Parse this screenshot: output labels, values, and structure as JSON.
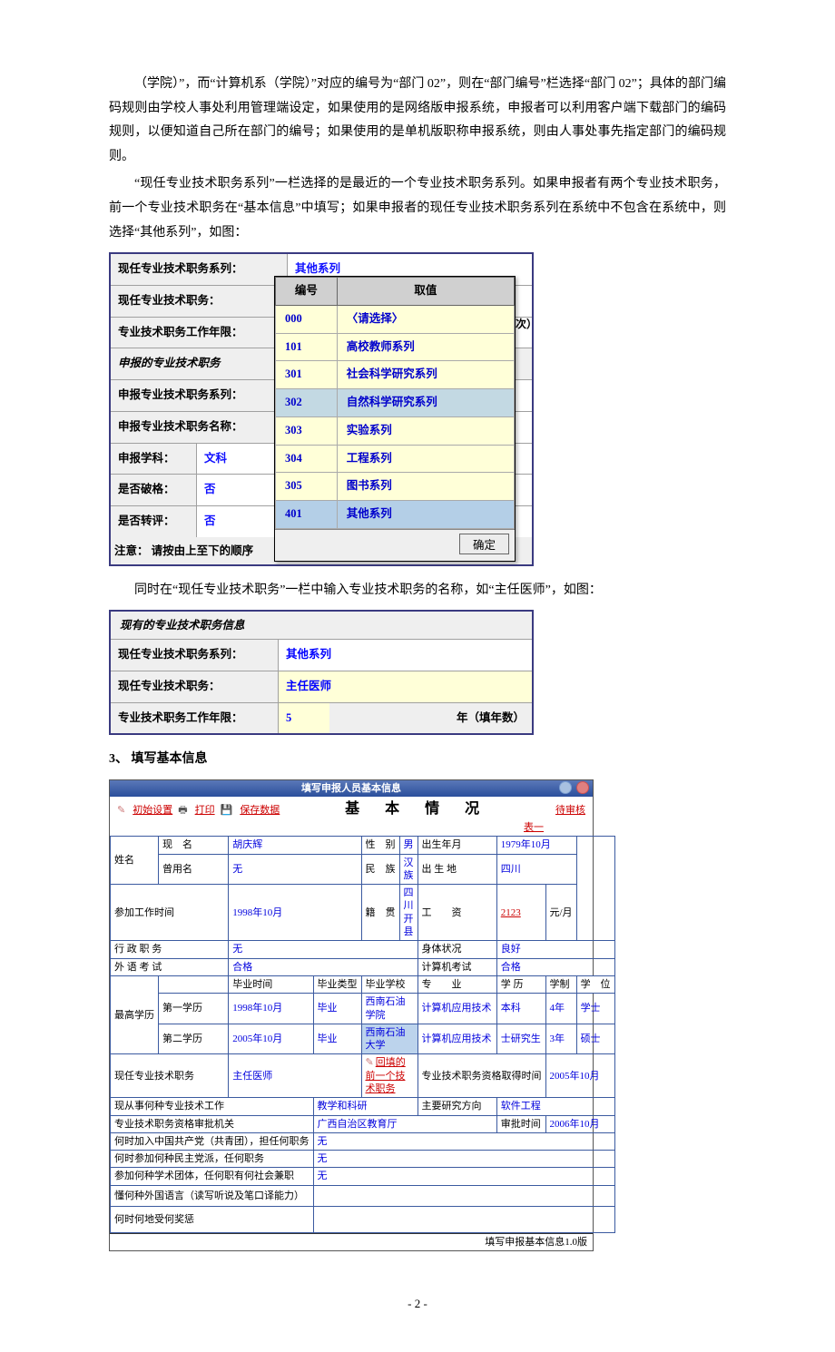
{
  "paragraphs": {
    "p1": "（学院）”，而“计算机系（学院）”对应的编号为“部门 02”，则在“部门编号”栏选择“部门 02”；具体的部门编码规则由学校人事处利用管理端设定，如果使用的是网络版申报系统，申报者可以利用客户端下载部门的编码规则，以便知道自己所在部门的编号；如果使用的是单机版职称申报系统，则由人事处事先指定部门的编码规则。",
    "p2": "“现任专业技术职务系列”一栏选择的是最近的一个专业技术职务系列。如果申报者有两个专业技术职务，前一个专业技术职务在“基本信息”中填写；如果申报者的现任专业技术职务系列在系统中不包含在系统中，则选择“其他系列”，如图：",
    "p3": "同时在“现任专业技术职务”一栏中输入专业技术职务的名称，如“主任医师”，如图：",
    "section3": "3、 填写基本信息"
  },
  "box1": {
    "r1_label": "现任专业技术职务系列：",
    "r1_value": "其他系列",
    "r2_label": "现任专业技术职务：",
    "r3_label": "专业技术职务工作年限：",
    "r4_label": "申报的专业技术职务",
    "r5_label": "申报专业技术职务系列：",
    "r6_label": "申报专业技术职务名称：",
    "r7_label": "申报学科：",
    "r7_value": "文科",
    "r8_label": "是否破格：",
    "r8_value": "否",
    "r9_label": "是否转评：",
    "r9_value": "否",
    "note_prefix": "注意：",
    "note": "请按由上至下的顺序",
    "badge_x": "次）",
    "dropdown": {
      "col1": "编号",
      "col2": "取值",
      "rows": [
        {
          "code": "000",
          "text": "〈请选择〉"
        },
        {
          "code": "101",
          "text": "高校教师系列"
        },
        {
          "code": "301",
          "text": "社会科学研究系列"
        },
        {
          "code": "302",
          "text": "自然科学研究系列"
        },
        {
          "code": "303",
          "text": "实验系列"
        },
        {
          "code": "304",
          "text": "工程系列"
        },
        {
          "code": "305",
          "text": "图书系列"
        },
        {
          "code": "401",
          "text": "其他系列"
        }
      ],
      "ok": "确定"
    }
  },
  "box2": {
    "title": "现有的专业技术职务信息",
    "r1_label": "现任专业技术职务系列：",
    "r1_value": "其他系列",
    "r2_label": "现任专业技术职务：",
    "r2_value": "主任医师",
    "r3_label": "专业技术职务工作年限：",
    "r3_value": "5",
    "r3_suffix": "年（填年数）"
  },
  "app3": {
    "titlebar": "填写申报人员基本信息",
    "toolbar": {
      "init": "初始设置",
      "print": "打印",
      "save": "保存数据",
      "bigtitle": "基 本 情 况",
      "audit": "待审核"
    },
    "table_label": "表一",
    "labels": {
      "xingming": "姓名",
      "xianming": "现　名",
      "cengyong": "曾用名",
      "xingbie": "性　别",
      "chusheng_ny": "出生年月",
      "minzu": "民　族",
      "chushengdi": "出 生 地",
      "canjia_time": "参加工作时间",
      "jiguan": "籍　贯",
      "gongzi": "工　　资",
      "gongzi_unit": "元/月",
      "xingzheng": "行 政 职 务",
      "shenti": "身体状况",
      "waiyu": "外 语 考 试",
      "jisuanji": "计算机考试",
      "zuigao_xl": "最高学历",
      "diyi_xl": "第一学历",
      "dier_xl": "第二学历",
      "biye_sj": "毕业时间",
      "biye_lx": "毕业类型",
      "biye_xx": "毕业学校",
      "zhuanye": "专　　业",
      "xueli": "学 历",
      "xuezhi": "学制",
      "xuewei": "学　位",
      "xianren_zw": "现任专业技术职务",
      "huitian": "回填的前一个技术职务",
      "zige_time": "专业技术职务资格取得时间",
      "xiancong": "现从事何种专业技术工作",
      "zhuyao": "主要研究方向",
      "shenpi_jg": "专业技术职务资格审批机关",
      "shenpi_time": "审批时间",
      "heshi_ccp": "何时加入中国共产党（共青团），担任何职务",
      "heshi_mz": "何时参加何种民主党派，任何职务",
      "xueshu_tt": "参加何种学术团体，任何职有何社会兼职",
      "waiyu_nl": "懂何种外国语言（读写听说及笔口译能力）",
      "jiangcheng": "何时何地受何奖惩"
    },
    "values": {
      "xianming": "胡庆辉",
      "cengyong": "无",
      "xingbie": "男",
      "chusheng_ny": "1979年10月",
      "minzu": "汉族",
      "chushengdi": "四川",
      "canjia_time": "1998年10月",
      "jiguan": "四川开县",
      "gongzi": "2123",
      "xingzheng": "无",
      "shenti": "良好",
      "waiyu": "合格",
      "jisuanji": "合格",
      "xl1_sj": "1998年10月",
      "xl1_lx": "毕业",
      "xl1_xx": "西南石油学院",
      "xl1_zy": "计算机应用技术",
      "xl1_xueli": "本科",
      "xl1_xz": "4年",
      "xl1_xw": "学士",
      "xl2_sj": "2005年10月",
      "xl2_lx": "毕业",
      "xl2_xx": "西南石油大学",
      "xl2_zy": "计算机应用技术",
      "xl2_xueli": "士研究生",
      "xl2_xz": "3年",
      "xl2_xw": "硕士",
      "xianren_zw": "主任医师",
      "zige_time": "2005年10月",
      "xiancong": "教学和科研",
      "zhuyao": "软件工程",
      "shenpi_jg": "广西自治区教育厅",
      "shenpi_time": "2006年10月",
      "heshi_ccp": "无",
      "heshi_mz": "无",
      "xueshu_tt": "无"
    },
    "footer": "填写申报基本信息1.0版"
  },
  "page_number": "- 2 -"
}
